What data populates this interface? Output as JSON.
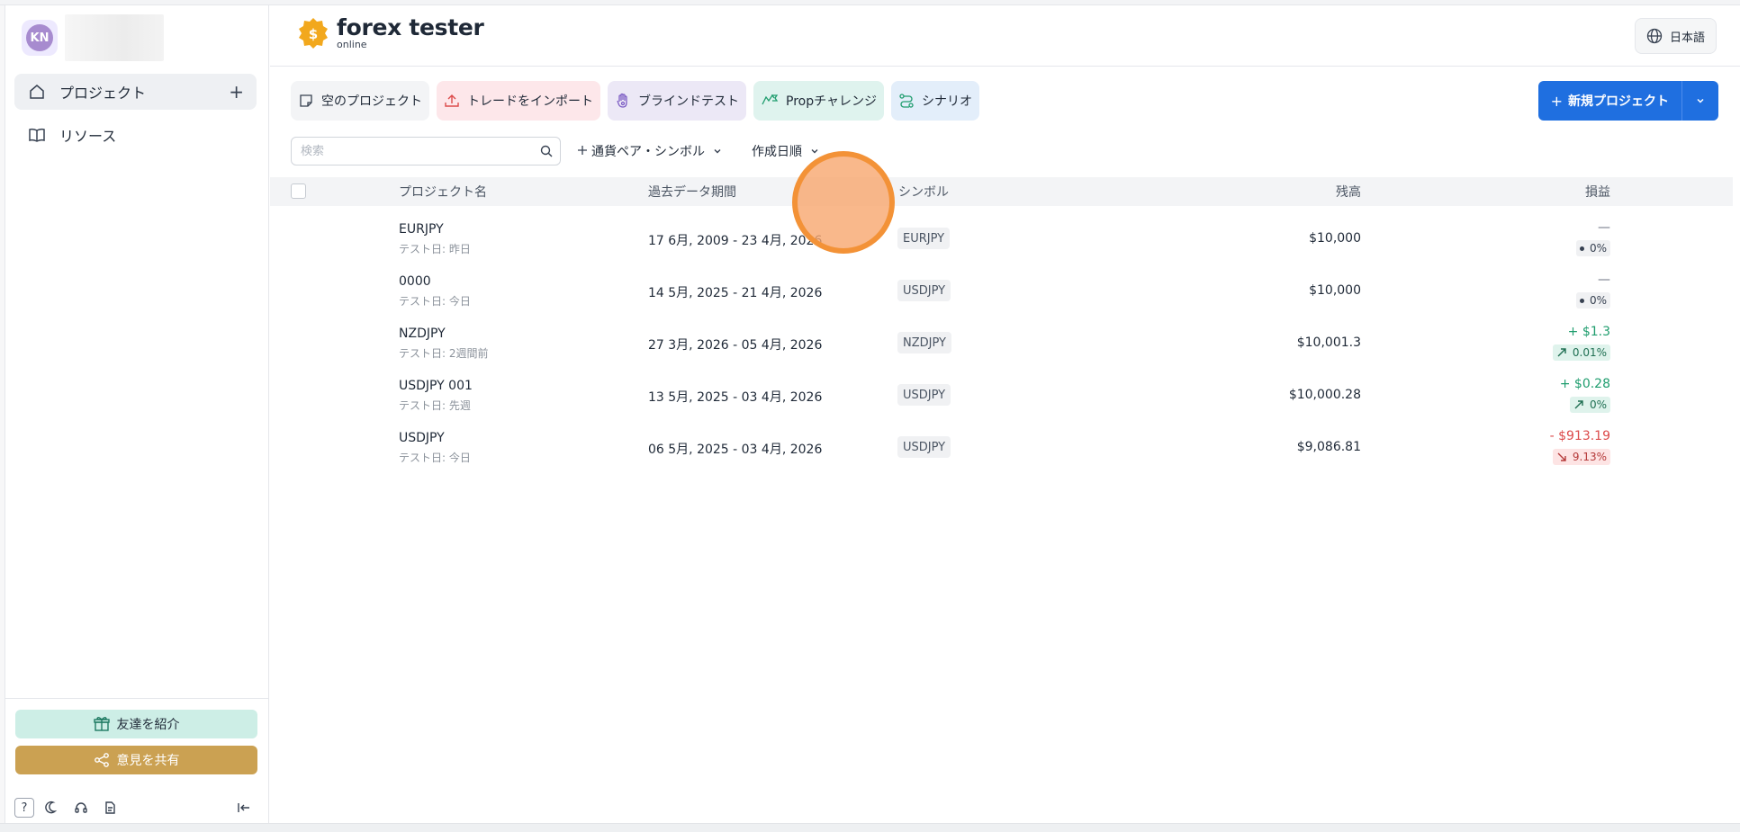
{
  "user": {
    "initials": "KN"
  },
  "sidebar": {
    "items": [
      {
        "label": "プロジェクト",
        "icon": "home-icon"
      },
      {
        "label": "リソース",
        "icon": "book-icon"
      }
    ],
    "invite_label": "友達を紹介",
    "share_label": "意見を共有",
    "help_label": "?"
  },
  "header": {
    "logo_main": "forex tester",
    "logo_sub": "online",
    "language": "日本語"
  },
  "quick_actions": [
    {
      "label": "空のプロジェクト",
      "icon": "note-icon"
    },
    {
      "label": "トレードをインポート",
      "icon": "upload-icon"
    },
    {
      "label": "ブラインドテスト",
      "icon": "hand-icon"
    },
    {
      "label": "Propチャレンジ",
      "icon": "prop-icon"
    },
    {
      "label": "シナリオ",
      "icon": "scenario-icon"
    }
  ],
  "new_project": {
    "label": "新規プロジェクト",
    "plus": "+"
  },
  "filters": {
    "search_placeholder": "検索",
    "symbol_filter": "通貨ペア・シンボル",
    "sort": "作成日順"
  },
  "table": {
    "headers": {
      "name": "プロジェクト名",
      "period": "過去データ期間",
      "symbol": "シンボル",
      "balance": "残高",
      "pl": "損益"
    },
    "rows": [
      {
        "name": "EURJPY",
        "sub": "テスト日: 昨日",
        "period": "17 6月, 2009 - 23 4月, 2026",
        "symbol": "EURJPY",
        "balance": "$10,000",
        "pl": "—",
        "pct": "0%",
        "trend": "neutral"
      },
      {
        "name": "0000",
        "sub": "テスト日: 今日",
        "period": "14 5月, 2025 - 21 4月, 2026",
        "symbol": "USDJPY",
        "balance": "$10,000",
        "pl": "—",
        "pct": "0%",
        "trend": "neutral"
      },
      {
        "name": "NZDJPY",
        "sub": "テスト日: 2週間前",
        "period": "27 3月, 2026 - 05 4月, 2026",
        "symbol": "NZDJPY",
        "balance": "$10,001.3",
        "pl": "+ $1.3",
        "pct": "0.01%",
        "trend": "up"
      },
      {
        "name": "USDJPY 001",
        "sub": "テスト日: 先週",
        "period": "13 5月, 2025 - 03 4月, 2026",
        "symbol": "USDJPY",
        "balance": "$10,000.28",
        "pl": "+ $0.28",
        "pct": "0%",
        "trend": "up"
      },
      {
        "name": "USDJPY",
        "sub": "テスト日: 今日",
        "period": "06 5月, 2025 - 03 4月, 2026",
        "symbol": "USDJPY",
        "balance": "$9,086.81",
        "pl": "- $913.19",
        "pct": "9.13%",
        "trend": "down"
      }
    ]
  },
  "colors": {
    "accent": "#1f6fe0",
    "positive": "#1f9d6e",
    "negative": "#dc4b4b",
    "logo": "#f2a81d"
  }
}
